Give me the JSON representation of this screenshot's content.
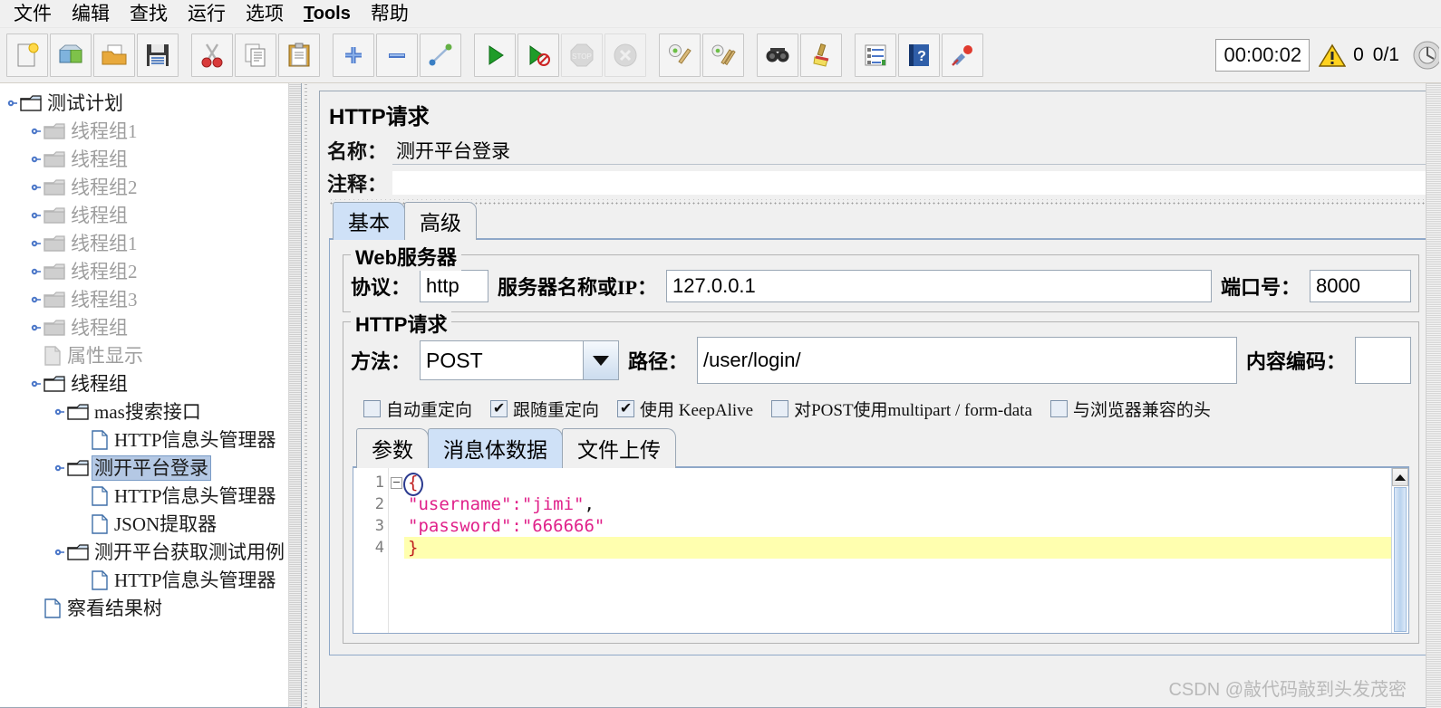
{
  "menu": {
    "items": [
      {
        "label": "文件",
        "latin": false
      },
      {
        "label": "编辑",
        "latin": false
      },
      {
        "label": "查找",
        "latin": false
      },
      {
        "label": "运行",
        "latin": false
      },
      {
        "label": "选项",
        "latin": false
      },
      {
        "label": "Tools",
        "latin": true
      },
      {
        "label": "帮助",
        "latin": false
      }
    ]
  },
  "toolbar": {
    "buttons": [
      {
        "name": "new-test-plan-icon",
        "enabled": true
      },
      {
        "name": "templates-icon",
        "enabled": true
      },
      {
        "name": "open-icon",
        "enabled": true
      },
      {
        "name": "save-icon",
        "enabled": true
      },
      {
        "name": "cut-icon",
        "enabled": true
      },
      {
        "name": "copy-icon",
        "enabled": true
      },
      {
        "name": "paste-icon",
        "enabled": true
      },
      {
        "name": "expand-all-icon",
        "enabled": true
      },
      {
        "name": "collapse-all-icon",
        "enabled": true
      },
      {
        "name": "toggle-icon",
        "enabled": true
      },
      {
        "name": "start-icon",
        "enabled": true
      },
      {
        "name": "start-no-pauses-icon",
        "enabled": true
      },
      {
        "name": "stop-icon",
        "enabled": false
      },
      {
        "name": "shutdown-icon",
        "enabled": false
      },
      {
        "name": "clear-icon",
        "enabled": true
      },
      {
        "name": "clear-all-icon",
        "enabled": true
      },
      {
        "name": "search-icon",
        "enabled": true
      },
      {
        "name": "reset-search-icon",
        "enabled": true
      },
      {
        "name": "function-helper-icon",
        "enabled": true
      },
      {
        "name": "help-icon",
        "enabled": true
      },
      {
        "name": "undo-redo-icon",
        "enabled": true
      }
    ],
    "timer": "00:00:02",
    "warning_count": "0",
    "thread_counts": "0/1"
  },
  "tree": {
    "nodes": [
      {
        "label": "测试计划",
        "depth": 0,
        "icon": "test-plan-folder-icon",
        "dim": false,
        "selected": false,
        "expander": "expanded"
      },
      {
        "label": "线程组1",
        "depth": 1,
        "icon": "thread-group-folder-icon",
        "dim": true,
        "selected": false,
        "expander": "collapsed"
      },
      {
        "label": "线程组",
        "depth": 1,
        "icon": "thread-group-folder-icon",
        "dim": true,
        "selected": false,
        "expander": "collapsed"
      },
      {
        "label": "线程组2",
        "depth": 1,
        "icon": "thread-group-folder-icon",
        "dim": true,
        "selected": false,
        "expander": "collapsed"
      },
      {
        "label": "线程组",
        "depth": 1,
        "icon": "thread-group-folder-icon",
        "dim": true,
        "selected": false,
        "expander": "collapsed"
      },
      {
        "label": "线程组1",
        "depth": 1,
        "icon": "thread-group-folder-icon",
        "dim": true,
        "selected": false,
        "expander": "collapsed"
      },
      {
        "label": "线程组2",
        "depth": 1,
        "icon": "thread-group-folder-icon",
        "dim": true,
        "selected": false,
        "expander": "collapsed"
      },
      {
        "label": "线程组3",
        "depth": 1,
        "icon": "thread-group-folder-icon",
        "dim": true,
        "selected": false,
        "expander": "collapsed"
      },
      {
        "label": "线程组",
        "depth": 1,
        "icon": "thread-group-folder-icon",
        "dim": true,
        "selected": false,
        "expander": "collapsed"
      },
      {
        "label": "属性显示",
        "depth": 1,
        "icon": "listener-doc-icon",
        "dim": true,
        "selected": false,
        "expander": "leaf"
      },
      {
        "label": "线程组",
        "depth": 1,
        "icon": "thread-group-folder-icon",
        "dim": false,
        "selected": false,
        "expander": "expanded"
      },
      {
        "label": "mas搜索接口",
        "depth": 2,
        "icon": "http-sampler-folder-icon",
        "dim": false,
        "selected": false,
        "expander": "expanded"
      },
      {
        "label": "HTTP信息头管理器",
        "depth": 3,
        "icon": "config-doc-icon",
        "dim": false,
        "selected": false,
        "expander": "leaf"
      },
      {
        "label": "测开平台登录",
        "depth": 2,
        "icon": "http-sampler-folder-icon",
        "dim": false,
        "selected": true,
        "expander": "expanded"
      },
      {
        "label": "HTTP信息头管理器",
        "depth": 3,
        "icon": "config-doc-icon",
        "dim": false,
        "selected": false,
        "expander": "leaf"
      },
      {
        "label": "JSON提取器",
        "depth": 3,
        "icon": "config-doc-icon",
        "dim": false,
        "selected": false,
        "expander": "leaf"
      },
      {
        "label": "测开平台获取测试用例",
        "depth": 2,
        "icon": "http-sampler-folder-icon",
        "dim": false,
        "selected": false,
        "expander": "expanded"
      },
      {
        "label": "HTTP信息头管理器",
        "depth": 3,
        "icon": "config-doc-icon",
        "dim": false,
        "selected": false,
        "expander": "leaf"
      },
      {
        "label": "察看结果树",
        "depth": 1,
        "icon": "listener-doc-icon",
        "dim": false,
        "selected": false,
        "expander": "leaf"
      }
    ]
  },
  "panel": {
    "title": "HTTP请求",
    "name_label": "名称：",
    "name_value": "测开平台登录",
    "comment_label": "注释：",
    "comment_value": "",
    "tabs": [
      {
        "label": "基本",
        "active": true
      },
      {
        "label": "高级",
        "active": false
      }
    ],
    "web_server": {
      "legend": "Web服务器",
      "protocol_label": "协议：",
      "protocol_value": "http",
      "server_label": "服务器名称或IP：",
      "server_value": "127.0.0.1",
      "port_label": "端口号：",
      "port_value": "8000"
    },
    "http_request": {
      "legend": "HTTP请求",
      "method_label": "方法：",
      "method_value": "POST",
      "path_label": "路径：",
      "path_value": "/user/login/",
      "encoding_label": "内容编码：",
      "encoding_value": "",
      "checkboxes": [
        {
          "label": "自动重定向",
          "checked": false
        },
        {
          "label": "跟随重定向",
          "checked": true
        },
        {
          "label": "使用 KeepAlive",
          "checked": true
        },
        {
          "label": "对POST使用multipart / form-data",
          "checked": false
        },
        {
          "label": "与浏览器兼容的头",
          "checked": false
        }
      ]
    },
    "body_tabs": [
      {
        "label": "参数",
        "active": false
      },
      {
        "label": "消息体数据",
        "active": true
      },
      {
        "label": "文件上传",
        "active": false
      }
    ],
    "body_editor": {
      "lines": [
        {
          "num": "1",
          "fold": true,
          "current": false,
          "segments": [
            {
              "text": "{",
              "type": "brace-circled"
            }
          ]
        },
        {
          "num": "2",
          "fold": false,
          "current": false,
          "segments": [
            {
              "text": "\"username\":\"jimi\"",
              "type": "str"
            },
            {
              "text": ",",
              "type": "punc"
            }
          ]
        },
        {
          "num": "3",
          "fold": false,
          "current": false,
          "segments": [
            {
              "text": "\"password\":\"666666\"",
              "type": "str"
            }
          ]
        },
        {
          "num": "4",
          "fold": false,
          "current": true,
          "segments": [
            {
              "text": "}",
              "type": "brace"
            }
          ]
        }
      ]
    }
  },
  "watermark": "CSDN @敲代码敲到头发茂密",
  "colors": {
    "selection_blue": "#b4c8e4",
    "tab_active": "#cfe1f7",
    "current_line": "#ffffaf",
    "string_magenta": "#e0218a",
    "brace_red": "#c02020",
    "panel_bg": "#f0f0f0"
  }
}
